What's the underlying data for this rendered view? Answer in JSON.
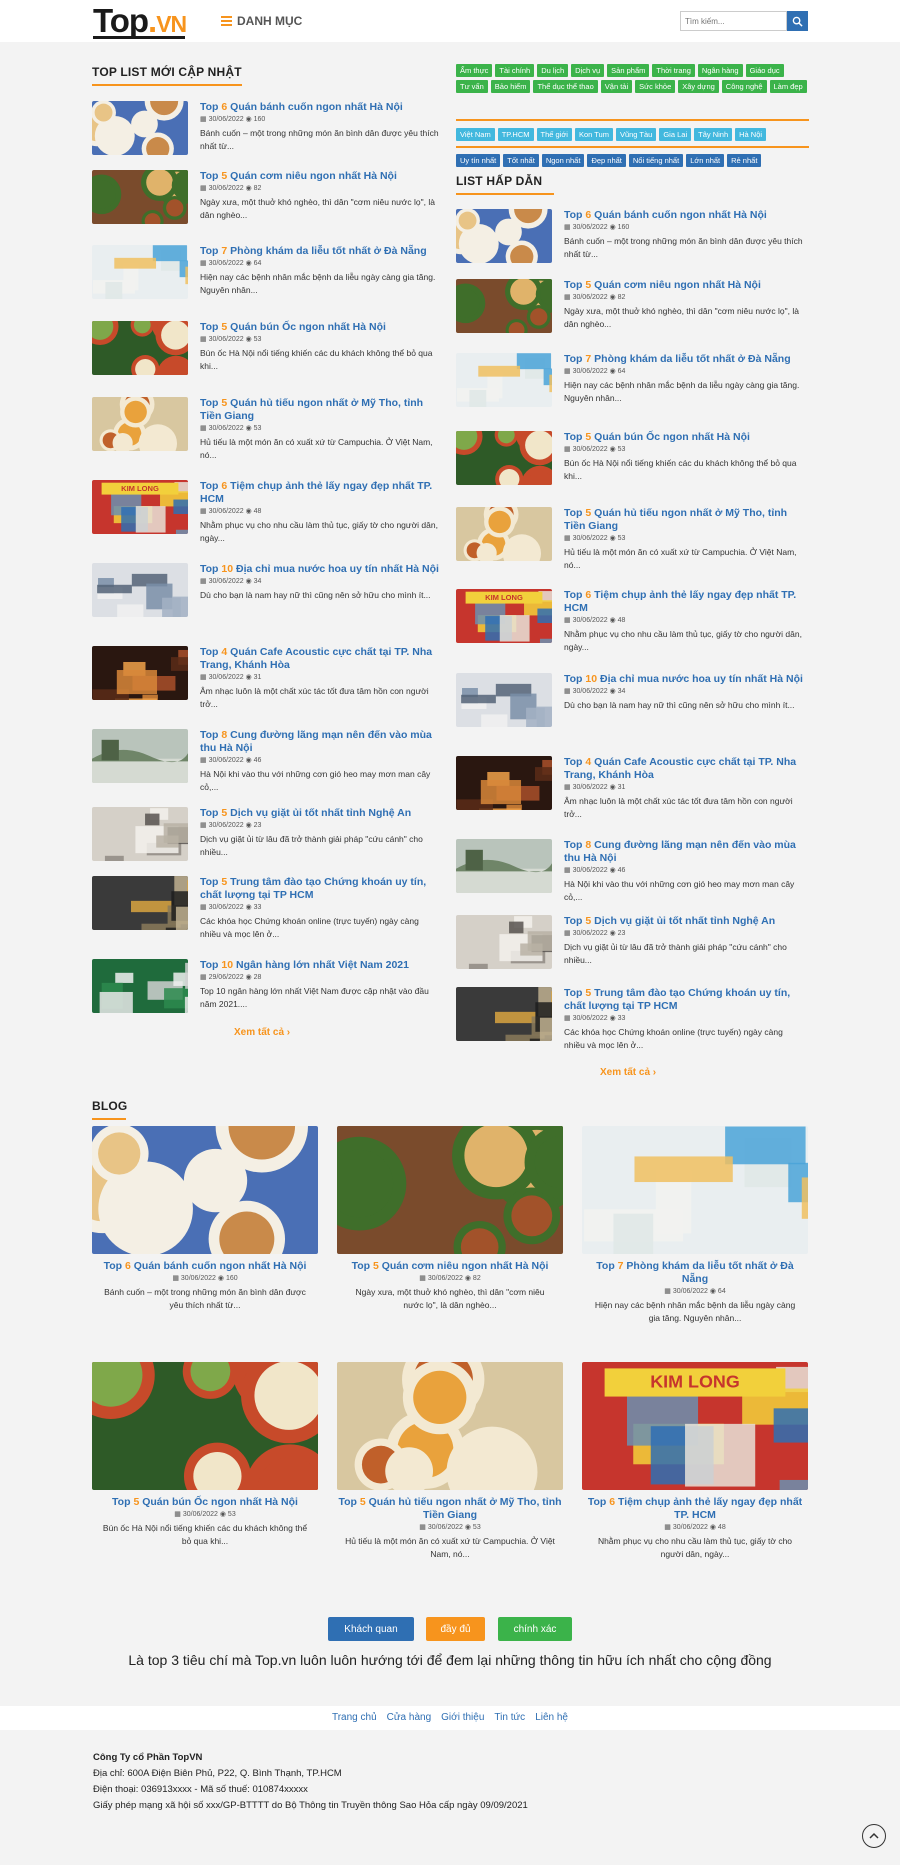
{
  "header": {
    "logo": {
      "top": "Top",
      "dot": ".",
      "vn": "VN"
    },
    "menu_label": "DANH MỤC",
    "search_placeholder": "Tìm kiếm..."
  },
  "new_list": {
    "title": "TOP LIST MỚI CẬP NHẬT",
    "more": "Xem tất cả  ›"
  },
  "hot_list": {
    "title": "LIST HẤP DẪN",
    "more": "Xem tất cả  ›"
  },
  "tags": {
    "green": [
      "Ẩm thực",
      "Tài chính",
      "Du lịch",
      "Dịch vụ",
      "Sản phẩm",
      "Thời trang",
      "Ngân hàng",
      "Giáo dục",
      "Tư vấn",
      "Bảo hiểm",
      "Thể dục thể thao",
      "Vận tải",
      "Sức khỏe",
      "Xây dựng",
      "Công nghệ",
      "Làm đẹp"
    ],
    "cyan": [
      "Việt Nam",
      "TP.HCM",
      "Thế giới",
      "Kon Tum",
      "Vũng Tàu",
      "Gia Lai",
      "Tây Ninh",
      "Hà Nội"
    ],
    "blue": [
      "Uy tín nhất",
      "Tốt nhất",
      "Ngon nhất",
      "Đẹp nhất",
      "Nổi tiếng nhất",
      "Lớn nhất",
      "Rẻ nhất"
    ]
  },
  "articles": [
    {
      "num": "6",
      "title": "Quán bánh cuốn ngon nhất Hà Nội",
      "date": "30/06/2022",
      "views": "160",
      "desc": "Bánh cuốn – một trong những món ăn bình dân được yêu thích nhất từ...",
      "img": "food-rolls"
    },
    {
      "num": "5",
      "title": "Quán cơm niêu ngon nhất Hà Nội",
      "date": "30/06/2022",
      "views": "82",
      "desc": "Ngày xưa, một thuở khó nghèo, thì dân \"cơm niêu nước lọ\", là dân nghèo...",
      "img": "food-table"
    },
    {
      "num": "7",
      "title": "Phòng khám da liễu tốt nhất ở Đà Nẵng",
      "date": "30/06/2022",
      "views": "64",
      "desc": "Hiện nay các bệnh nhân mắc bệnh da liễu ngày càng gia tăng. Nguyên nhân...",
      "img": "clinic"
    },
    {
      "num": "5",
      "title": "Quán bún Ốc ngon nhất Hà Nội",
      "date": "30/06/2022",
      "views": "53",
      "desc": "Bún ốc Hà Nội nổi tiếng khiến các du khách không thể bỏ qua khi...",
      "img": "noodle-bowls"
    },
    {
      "num": "5",
      "title": "Quán hủ tiếu ngon nhất ở Mỹ Tho, tỉnh Tiền Giang",
      "date": "30/06/2022",
      "views": "53",
      "desc": "Hủ tiếu là một món ăn có xuất xứ từ Campuchia. Ở Việt Nam, nó...",
      "img": "soup-bowl"
    },
    {
      "num": "6",
      "title": "Tiệm chụp ảnh thẻ lấy ngay đẹp nhất TP. HCM",
      "date": "30/06/2022",
      "views": "48",
      "desc": "Nhằm phục vụ cho nhu cầu làm thủ tục, giấy tờ cho người dân, ngày...",
      "img": "shop-front"
    },
    {
      "num": "10",
      "title": "Địa chỉ mua nước hoa uy tín nhất Hà Nội",
      "date": "30/06/2022",
      "views": "34",
      "desc": "Dù cho bạn là nam hay nữ thì cũng nên sở hữu cho mình ít...",
      "img": "perfume-shop"
    },
    {
      "num": "4",
      "title": "Quán Cafe Acoustic cực chất tại TP. Nha Trang, Khánh Hòa",
      "date": "30/06/2022",
      "views": "31",
      "desc": "Âm nhạc luôn là một chất xúc tác tốt đưa tâm hồn con người trở...",
      "img": "cafe-night"
    },
    {
      "num": "8",
      "title": "Cung đường lãng mạn nên đến vào mùa thu Hà Nội",
      "date": "30/06/2022",
      "views": "46",
      "desc": "Hà Nội khi vào thu với những cơn gió heo may mơn man cây cỏ,...",
      "img": "lake"
    },
    {
      "num": "5",
      "title": "Dịch vụ giặt ủi tốt nhất tỉnh Nghệ An",
      "date": "30/06/2022",
      "views": "23",
      "desc": "Dịch vụ giặt ủi từ lâu đã trở thành giải pháp \"cứu cánh\" cho nhiều...",
      "img": "laundry"
    },
    {
      "num": "5",
      "title": "Trung tâm đào tạo Chứng khoán uy tín, chất lượng tại TP HCM",
      "date": "30/06/2022",
      "views": "33",
      "desc": "Các khóa học Chứng khoán online (trực tuyến) ngày càng nhiều và mọc lên ở...",
      "img": "building"
    },
    {
      "num": "10",
      "title": "Ngân hàng lớn nhất Việt Nam 2021",
      "date": "29/06/2022",
      "views": "28",
      "desc": "Top 10 ngân hàng lớn nhất Việt Nam được cập nhật vào đầu năm 2021....",
      "img": "bank"
    }
  ],
  "blog": {
    "title": "BLOG"
  },
  "buttons": {
    "b1": "Khách quan",
    "b2": "đầy đủ",
    "b3": "chính xác"
  },
  "slogan": "Là top 3 tiêu chí mà Top.vn luôn luôn hướng tới để đem lại những thông tin hữu ích nhất cho cộng đồng",
  "footer_nav": [
    "Trang chủ",
    "Cửa hàng",
    "Giới thiệu",
    "Tin tức",
    "Liên hệ"
  ],
  "footer": {
    "company": "Công Ty cổ Phần TopVN",
    "address": "Địa chỉ: 600A Điện Biên Phủ, P22, Q. Bình Thạnh, TP.HCM",
    "phone": "Điện thoại: 036913xxxx - Mã số thuế: 010874xxxxx",
    "license": "Giấy phép mạng xã hội số xxx/GP-BTTTT do Bộ Thông tin Truyền thông Sao Hỏa cấp ngày 09/09/2021"
  },
  "colors": {
    "accent": "#f7941d",
    "link": "#2f6fb3",
    "tag_green": "#3bb34a",
    "tag_cyan": "#42b8de"
  }
}
